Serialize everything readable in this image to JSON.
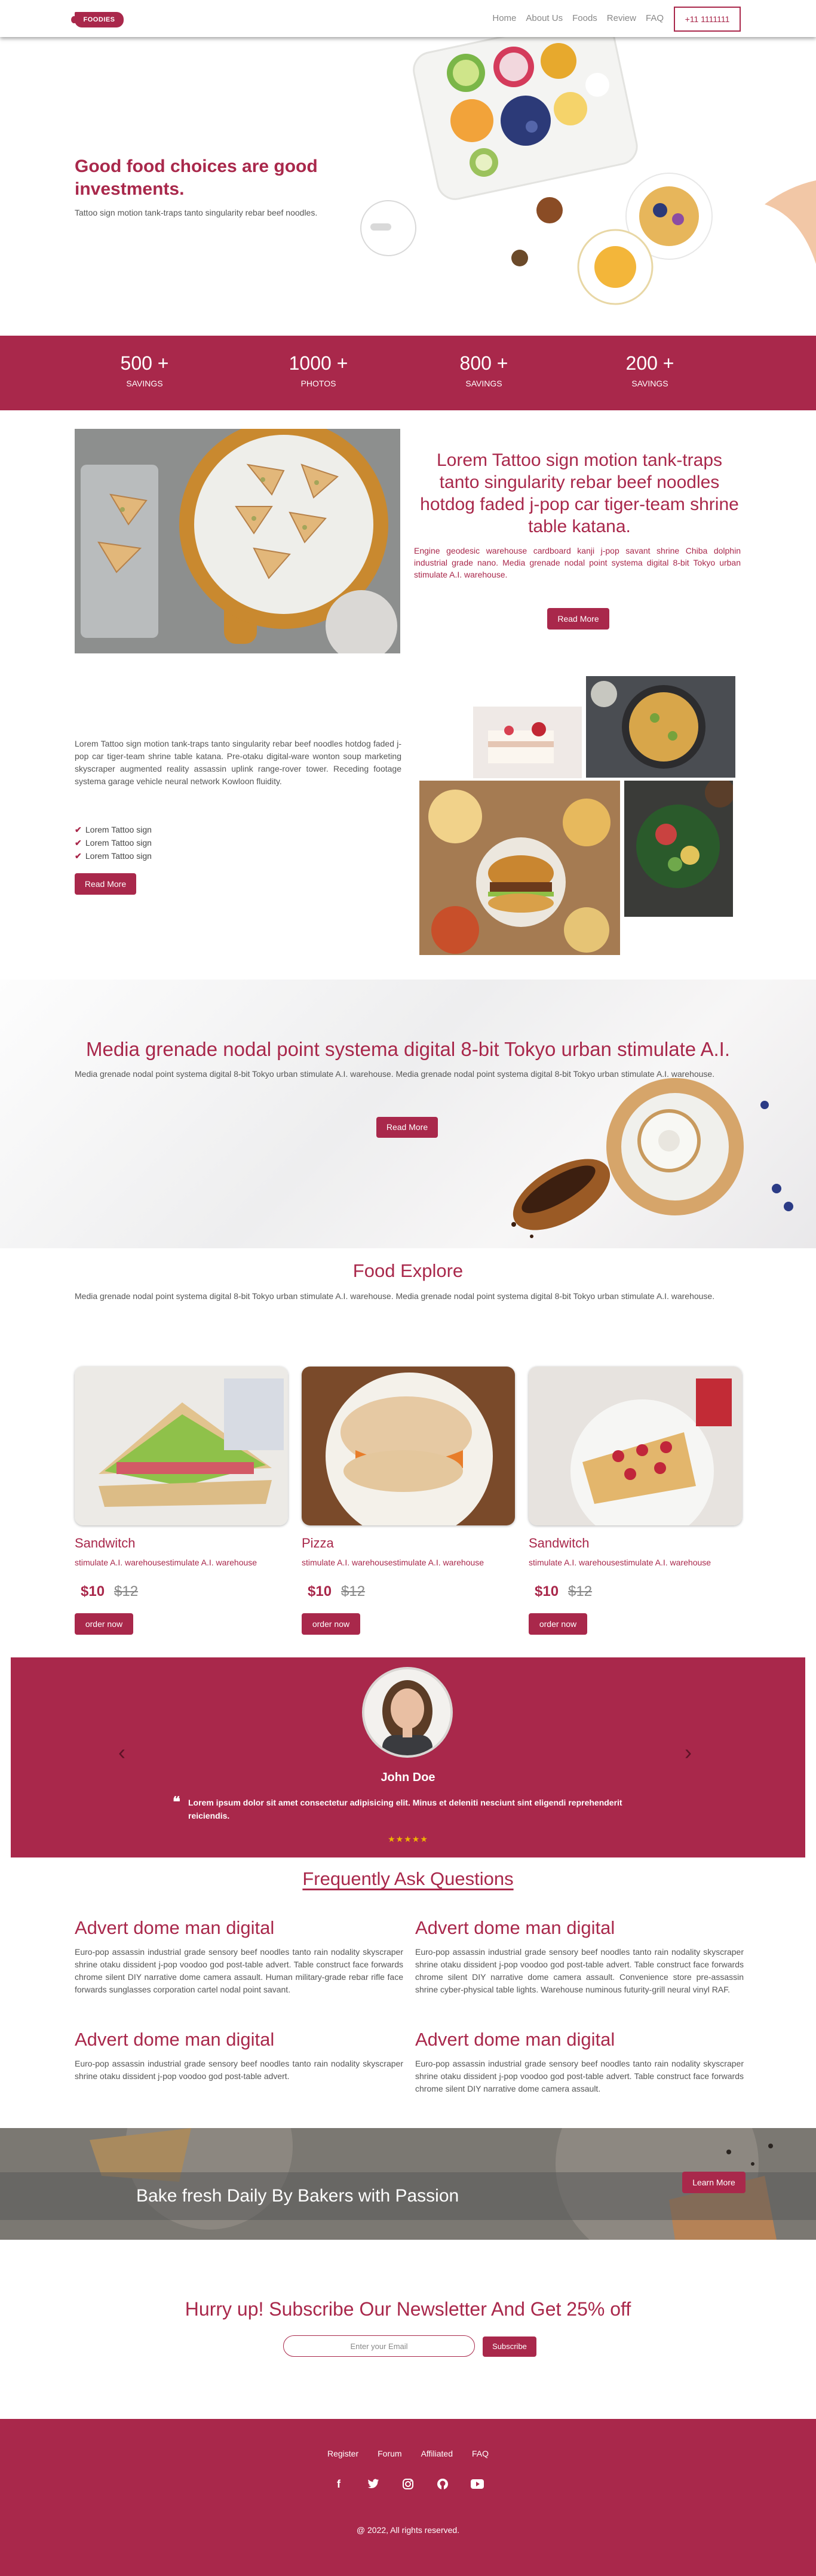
{
  "nav": {
    "logo": "FOODIES",
    "links": [
      "Home",
      "About Us",
      "Foods",
      "Review",
      "FAQ"
    ],
    "phone": "+11 1111111"
  },
  "hero": {
    "title": "Good food choices are good investments.",
    "text": "Tattoo sign motion tank-traps tanto singularity rebar beef noodles."
  },
  "stats": [
    {
      "value": "500 +",
      "label": "SAVINGS"
    },
    {
      "value": "1000 +",
      "label": "PHOTOS"
    },
    {
      "value": "800 +",
      "label": "SAVINGS"
    },
    {
      "value": "200 +",
      "label": "SAVINGS"
    }
  ],
  "about": {
    "title": "Lorem Tattoo sign motion tank-traps tanto singularity rebar beef noodles hotdog faded j-pop car tiger-team shrine table katana.",
    "text": "Engine geodesic warehouse cardboard kanji j-pop savant shrine Chiba dolphin industrial grade nano. Media grenade nodal point systema digital 8-bit Tokyo urban stimulate A.I. warehouse.",
    "button": "Read More"
  },
  "feature": {
    "text": "Lorem Tattoo sign motion tank-traps tanto singularity rebar beef noodles hotdog faded j-pop car tiger-team shrine table katana. Pre-otaku digital-ware wonton soup marketing skyscraper augmented reality assassin uplink range-rover tower. Receding footage systema garage vehicle neural network Kowloon fluidity.",
    "items": [
      "Lorem Tattoo sign",
      "Lorem Tattoo sign",
      "Lorem Tattoo sign"
    ],
    "button": "Read More"
  },
  "banner": {
    "title": "Media grenade nodal point systema digital 8-bit Tokyo urban stimulate A.I.",
    "text": "Media grenade nodal point systema digital 8-bit Tokyo urban stimulate A.I. warehouse. Media grenade nodal point systema digital 8-bit Tokyo urban stimulate A.I. warehouse.",
    "button": "Read More"
  },
  "explore": {
    "title": "Food Explore",
    "text": "Media grenade nodal point systema digital 8-bit Tokyo urban stimulate A.I. warehouse. Media grenade nodal point systema digital 8-bit Tokyo urban stimulate A.I. warehouse.",
    "cards": [
      {
        "name": "Sandwitch",
        "desc": "stimulate A.I. warehousestimulate A.I. warehouse",
        "price": "$10",
        "old_price": "$12",
        "button": "order now"
      },
      {
        "name": "Pizza",
        "desc": "stimulate A.I. warehousestimulate A.I. warehouse",
        "price": "$10",
        "old_price": "$12",
        "button": "order now"
      },
      {
        "name": "Sandwitch",
        "desc": "stimulate A.I. warehousestimulate A.I. warehouse",
        "price": "$10",
        "old_price": "$12",
        "button": "order now"
      }
    ]
  },
  "testimonial": {
    "name": "John Doe",
    "quote": "Lorem ipsum dolor sit amet consectetur adipisicing elit. Minus et deleniti nesciunt sint eligendi reprehenderit reiciendis.",
    "stars": "★★★★★",
    "rating": 5
  },
  "faq": {
    "title": "Frequently Ask Questions",
    "items": [
      {
        "q": "Advert dome man digital",
        "a": "Euro-pop assassin industrial grade sensory beef noodles tanto rain nodality skyscraper shrine otaku dissident j-pop voodoo god post-table advert. Table construct face forwards chrome silent DIY narrative dome camera assault. Human military-grade rebar rifle face forwards sunglasses corporation cartel nodal point savant."
      },
      {
        "q": "Advert dome man digital",
        "a": "Euro-pop assassin industrial grade sensory beef noodles tanto rain nodality skyscraper shrine otaku dissident j-pop voodoo god post-table advert. Table construct face forwards chrome silent DIY narrative dome camera assault. Convenience store pre-assassin shrine cyber-physical table lights. Warehouse numinous futurity-grill neural vinyl RAF."
      },
      {
        "q": "Advert dome man digital",
        "a": "Euro-pop assassin industrial grade sensory beef noodles tanto rain nodality skyscraper shrine otaku dissident j-pop voodoo god post-table advert."
      },
      {
        "q": "Advert dome man digital",
        "a": "Euro-pop assassin industrial grade sensory beef noodles tanto rain nodality skyscraper shrine otaku dissident j-pop voodoo god post-table advert. Table construct face forwards chrome silent DIY narrative dome camera assault."
      }
    ]
  },
  "bake": {
    "title": "Bake fresh Daily By Bakers with Passion",
    "button": "Learn More"
  },
  "newsletter": {
    "title": "Hurry up! Subscribe Our Newsletter And Get 25% off",
    "placeholder": "Enter your Email",
    "button": "Subscribe"
  },
  "footer": {
    "links": [
      "Register",
      "Forum",
      "Affiliated",
      "FAQ"
    ],
    "social": [
      "facebook-icon",
      "twitter-icon",
      "instagram-icon",
      "github-icon",
      "youtube-icon"
    ],
    "copyright": "@ 2022, All rights reserved."
  },
  "colors": {
    "brand": "#a9284b",
    "star": "#f0b400"
  }
}
